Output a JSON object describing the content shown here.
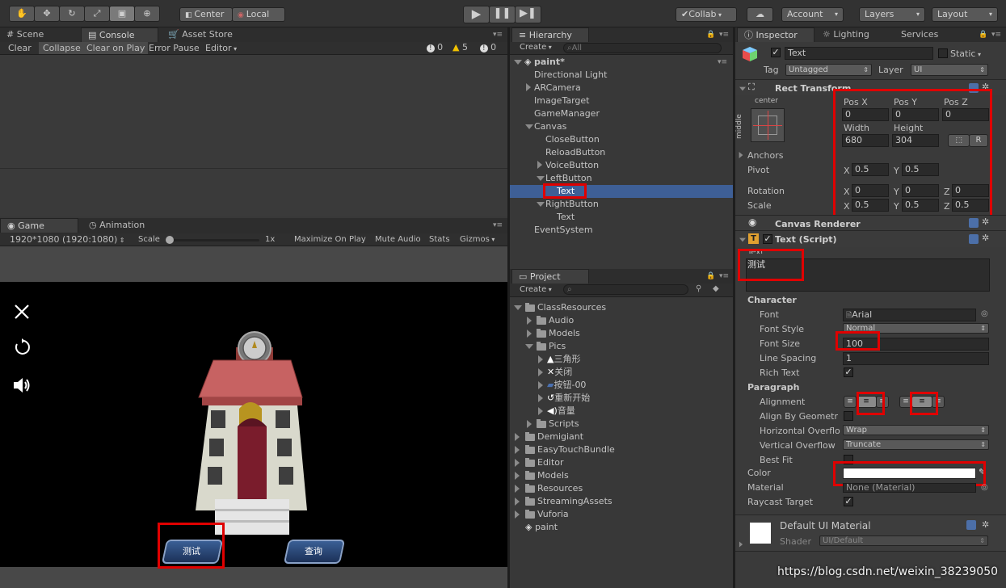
{
  "toolbar": {
    "center_label": "Center",
    "local_label": "Local",
    "collab_label": "Collab",
    "account_label": "Account",
    "layers_label": "Layers",
    "layout_label": "Layout"
  },
  "console": {
    "tabs": [
      "Scene",
      "Console",
      "Asset Store"
    ],
    "buttons": [
      "Clear",
      "Collapse",
      "Clear on Play",
      "Error Pause",
      "Editor"
    ],
    "counts": {
      "errors": "0",
      "warnings": "5",
      "messages": "0"
    }
  },
  "game": {
    "tabs": [
      "Game",
      "Animation"
    ],
    "resolution": "1920*1080 (1920:1080)",
    "scale_label": "Scale",
    "scale_value": "1x",
    "buttons": [
      "Maximize On Play",
      "Mute Audio",
      "Stats",
      "Gizmos"
    ],
    "left_button_text": "测试",
    "right_button_text": "查询"
  },
  "hierarchy": {
    "tab": "Hierarchy",
    "create": "Create",
    "search_placeholder": "All",
    "scene": "paint*",
    "items": [
      "Directional Light",
      "ARCamera",
      "ImageTarget",
      "GameManager",
      "Canvas",
      "CloseButton",
      "ReloadButton",
      "VoiceButton",
      "LeftButton",
      "Text",
      "RightButton",
      "Text",
      "EventSystem"
    ]
  },
  "project": {
    "tab": "Project",
    "create": "Create",
    "items": [
      "ClassResources",
      "Audio",
      "Models",
      "Pics",
      "三角形",
      "关闭",
      "按钮-00",
      "重新开始",
      "音量",
      "Scripts",
      "Demigiant",
      "EasyTouchBundle",
      "Editor",
      "Models",
      "Resources",
      "StreamingAssets",
      "Vuforia",
      "paint"
    ]
  },
  "inspector": {
    "tabs": [
      "Inspector",
      "Lighting",
      "Services"
    ],
    "object_name": "Text",
    "static_label": "Static",
    "tag_label": "Tag",
    "tag_value": "Untagged",
    "layer_label": "Layer",
    "layer_value": "UI",
    "rect_transform": {
      "title": "Rect Transform",
      "anchor_h": "center",
      "anchor_v": "middle",
      "pos_x_label": "Pos X",
      "pos_y_label": "Pos Y",
      "pos_z_label": "Pos Z",
      "pos_x": "0",
      "pos_y": "0",
      "pos_z": "0",
      "width_label": "Width",
      "height_label": "Height",
      "width": "680",
      "height": "304",
      "r_label": "R",
      "anchors_label": "Anchors",
      "pivot_label": "Pivot",
      "pivot_x": "0.5",
      "pivot_y": "0.5",
      "rotation_label": "Rotation",
      "rot_x": "0",
      "rot_y": "0",
      "rot_z": "0",
      "scale_label": "Scale",
      "scale_x": "0.5",
      "scale_y": "0.5",
      "scale_z": "0.5",
      "x_label": "X",
      "y_label": "Y",
      "z_label": "Z"
    },
    "canvas_renderer": "Canvas Renderer",
    "text_script": {
      "title": "Text (Script)",
      "text_label": "Text",
      "text_value": "测试",
      "character_label": "Character",
      "font_label": "Font",
      "font_value": "Arial",
      "font_style_label": "Font Style",
      "font_style_value": "Normal",
      "font_size_label": "Font Size",
      "font_size_value": "100",
      "line_spacing_label": "Line Spacing",
      "line_spacing_value": "1",
      "rich_text_label": "Rich Text",
      "paragraph_label": "Paragraph",
      "alignment_label": "Alignment",
      "align_geometry_label": "Align By Geometr",
      "h_overflow_label": "Horizontal Overflo",
      "h_overflow_value": "Wrap",
      "v_overflow_label": "Vertical Overflow",
      "v_overflow_value": "Truncate",
      "best_fit_label": "Best Fit",
      "color_label": "Color",
      "color_value": "#ffffff",
      "material_label": "Material",
      "material_value": "None (Material)",
      "raycast_label": "Raycast Target"
    },
    "material": {
      "name": "Default UI Material",
      "shader_label": "Shader",
      "shader_value": "UI/Default"
    }
  },
  "watermark": "https://blog.csdn.net/weixin_38239050"
}
